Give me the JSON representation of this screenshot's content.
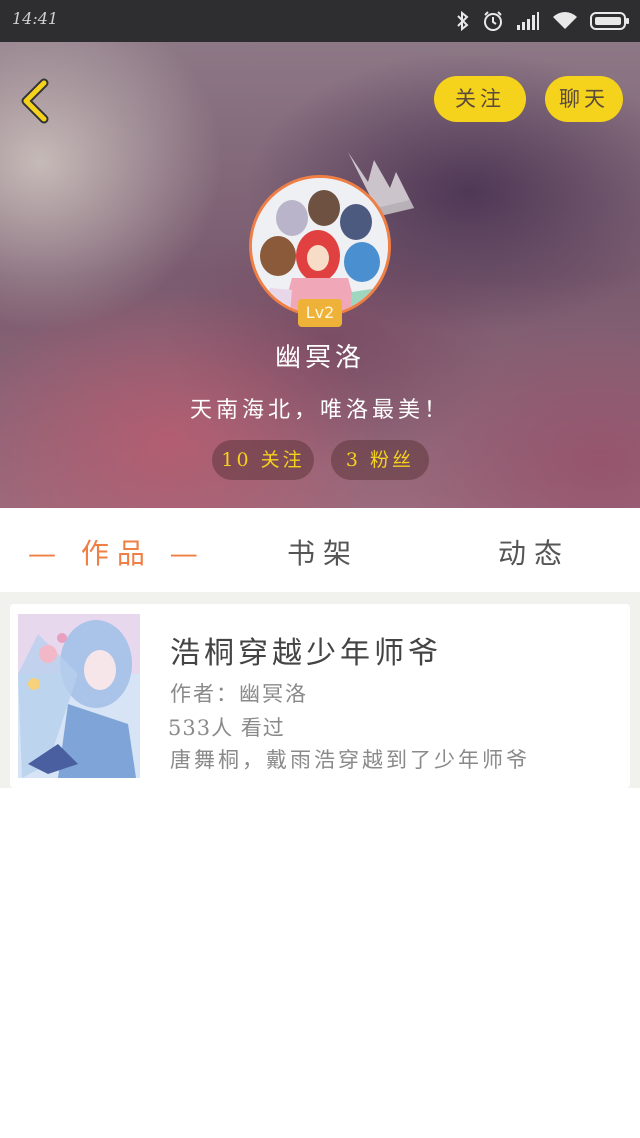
{
  "status_bar": {
    "time": "14:41",
    "icons": [
      "bluetooth-icon",
      "alarm-icon",
      "signal-icon",
      "wifi-icon",
      "battery-icon"
    ]
  },
  "header": {
    "follow_label": "关注",
    "chat_label": "聊天",
    "level": "Lv2",
    "username": "幽冥洛",
    "motto": "天南海北，唯洛最美！",
    "following": "10 关注",
    "fans": "3 粉丝"
  },
  "tabs": [
    {
      "label": "— 作品 —",
      "active": true
    },
    {
      "label": "书架",
      "active": false
    },
    {
      "label": "动态",
      "active": false
    }
  ],
  "works": [
    {
      "title": "浩桐穿越少年师爷",
      "author": "作者：幽冥洛",
      "views": "533人 看过",
      "description": "唐舞桐，戴雨浩穿越到了少年师爷"
    }
  ],
  "colors": {
    "accent": "#ef7f45",
    "button": "#f5d21c",
    "level_badge": "#efb238"
  }
}
